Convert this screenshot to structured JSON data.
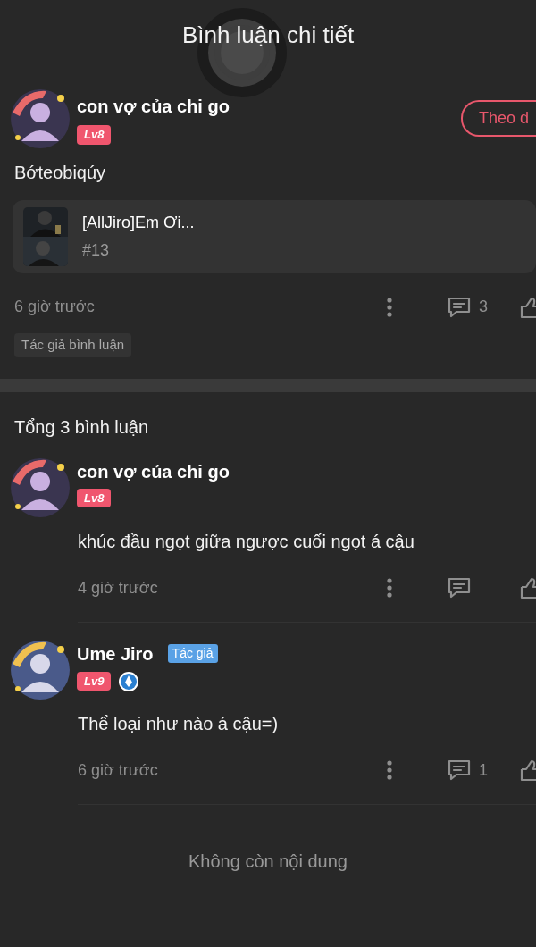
{
  "header": {
    "title": "Bình luận chi tiết"
  },
  "post": {
    "author": "con vợ của chi go",
    "level": "Lv8",
    "follow_button": "Theo d",
    "text": "Bớteobiqúy",
    "linked_work": {
      "title": "[AllJiro]Em Ơi...",
      "chapter": "#13"
    },
    "time": "6 giờ trước",
    "reply_count": "3",
    "tag": "Tác giả bình luận"
  },
  "comments_total": "Tổng 3 bình luận",
  "comments": [
    {
      "author": "con vợ của chi go",
      "level": "Lv8",
      "medal": false,
      "text": "khúc đầu ngọt giữa ngược cuối ngọt á cậu",
      "time": "4 giờ trước"
    },
    {
      "author": "Ume Jiro",
      "author_badge": "Tác giả",
      "level": "Lv9",
      "medal": true,
      "text": "Thể loại như nào á cậu=)",
      "time": "6 giờ trước",
      "reply_count": "1"
    }
  ],
  "end_text": "Không còn nội dung"
}
